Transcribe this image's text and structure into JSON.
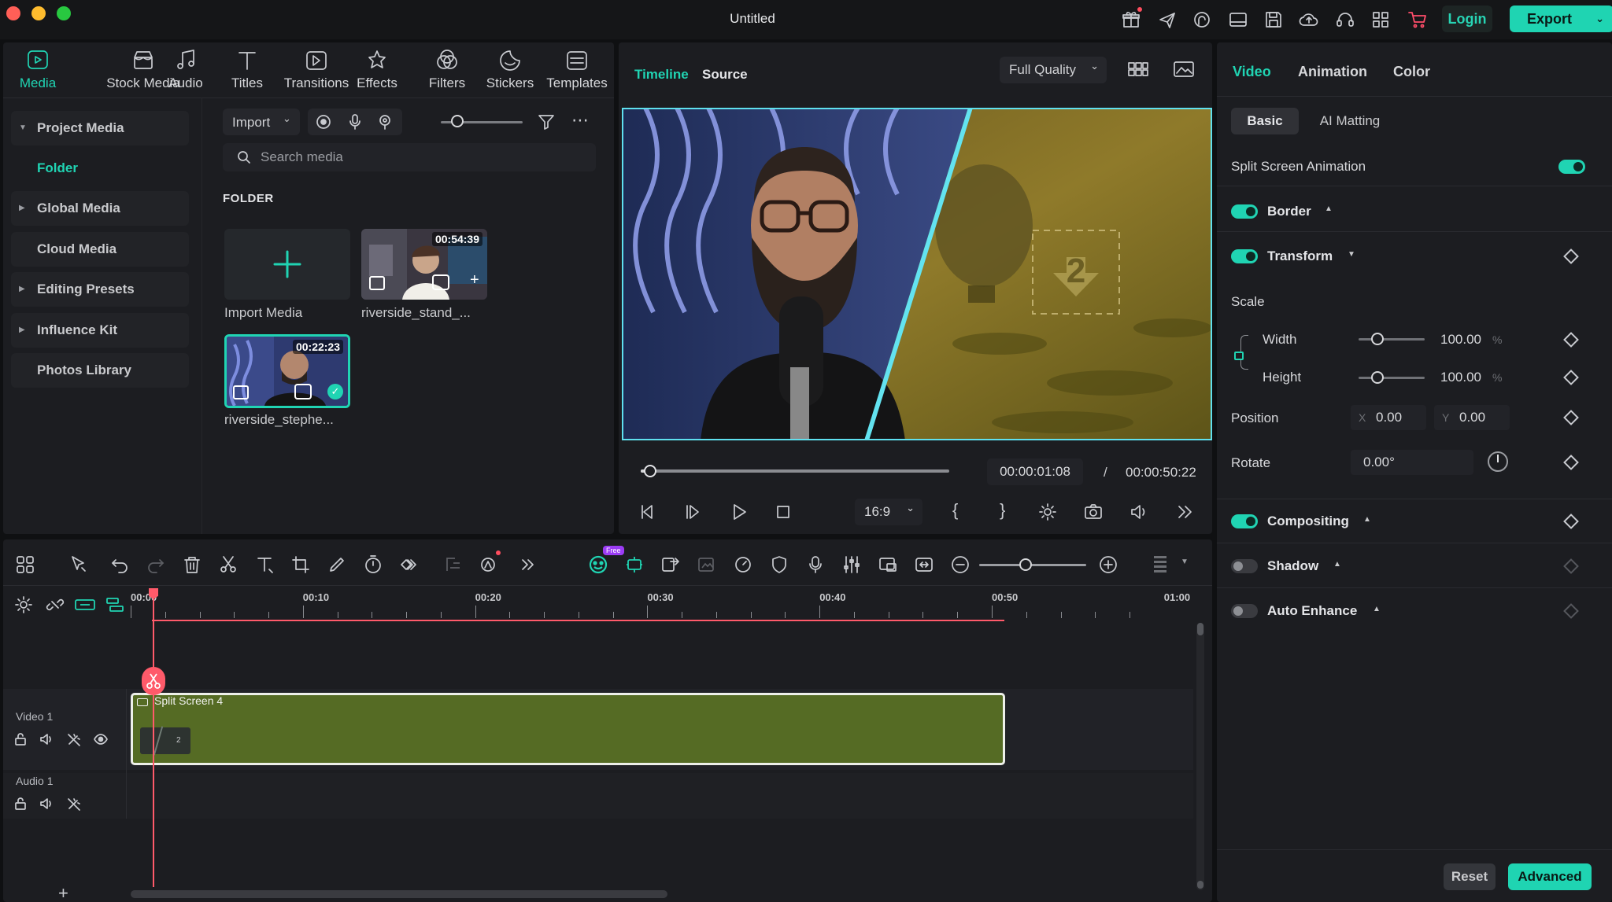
{
  "window": {
    "title": "Untitled"
  },
  "titlebar": {
    "login_label": "Login",
    "export_label": "Export"
  },
  "media_tabs": [
    {
      "label": "Media",
      "icon": "media-icon",
      "active": true
    },
    {
      "label": "Stock Media",
      "icon": "stock-media-icon"
    },
    {
      "label": "Audio",
      "icon": "audio-icon"
    },
    {
      "label": "Titles",
      "icon": "titles-icon"
    },
    {
      "label": "Transitions",
      "icon": "transitions-icon"
    },
    {
      "label": "Effects",
      "icon": "effects-icon"
    },
    {
      "label": "Filters",
      "icon": "filters-icon"
    },
    {
      "label": "Stickers",
      "icon": "stickers-icon"
    },
    {
      "label": "Templates",
      "icon": "templates-icon"
    }
  ],
  "sidebar": {
    "items": [
      {
        "label": "Project Media",
        "expanded": true
      },
      {
        "label": "Folder",
        "active": true
      },
      {
        "label": "Global Media"
      },
      {
        "label": "Cloud Media"
      },
      {
        "label": "Editing Presets"
      },
      {
        "label": "Influence Kit"
      },
      {
        "label": "Photos Library"
      }
    ]
  },
  "media": {
    "import_label": "Import",
    "search_placeholder": "Search media",
    "folder_title": "FOLDER",
    "import_media_label": "Import Media",
    "items": [
      {
        "name": "riverside_stand_...",
        "duration": "00:54:39"
      },
      {
        "name": "riverside_stephe...",
        "duration": "00:22:23",
        "selected": true
      }
    ]
  },
  "preview": {
    "tabs": [
      "Timeline",
      "Source"
    ],
    "quality": "Full Quality",
    "current_time": "00:00:01:08",
    "separator": "/",
    "total_time": "00:00:50:22",
    "aspect_ratio": "16:9",
    "progress": 0.03
  },
  "properties": {
    "tabs": [
      "Video",
      "Animation",
      "Color"
    ],
    "subtabs": [
      "Basic",
      "AI Matting"
    ],
    "split_screen_animation_label": "Split Screen Animation",
    "border_label": "Border",
    "transform_label": "Transform",
    "scale_label": "Scale",
    "width_label": "Width",
    "width_value": "100.00",
    "height_label": "Height",
    "height_value": "100.00",
    "unit_percent": "%",
    "position_label": "Position",
    "pos_x_label": "X",
    "pos_x_value": "0.00",
    "pos_y_label": "Y",
    "pos_y_value": "0.00",
    "rotate_label": "Rotate",
    "rotate_value": "0.00°",
    "compositing_label": "Compositing",
    "shadow_label": "Shadow",
    "auto_enhance_label": "Auto Enhance",
    "reset_label": "Reset",
    "advanced_label": "Advanced"
  },
  "timeline": {
    "free_badge": "Free",
    "ruler": [
      "00:00",
      "00:10",
      "00:20",
      "00:30",
      "00:40",
      "00:50",
      "01:00"
    ],
    "tracks": [
      {
        "label": "Video 1"
      },
      {
        "label": "Audio 1"
      }
    ],
    "clip_label": "Split Screen 4",
    "clip_badge": "2"
  },
  "colors": {
    "accent": "#20d4b3",
    "playhead": "#ff5a6a",
    "clip": "#556b24"
  }
}
